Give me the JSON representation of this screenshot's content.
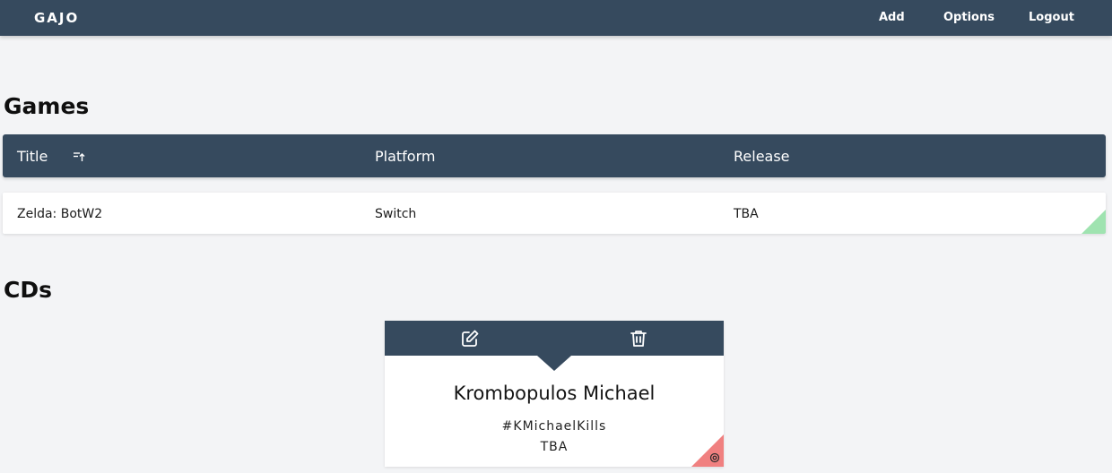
{
  "navbar": {
    "brand": "GAJO",
    "links": {
      "add": "Add",
      "options": "Options",
      "logout": "Logout"
    }
  },
  "games": {
    "heading": "Games",
    "columns": {
      "title": "Title",
      "platform": "Platform",
      "release": "Release"
    },
    "rows": [
      {
        "title": "Zelda: BotW2",
        "platform": "Switch",
        "release": "TBA"
      }
    ]
  },
  "cds": {
    "heading": "CDs",
    "items": [
      {
        "title": "Krombopulos Michael",
        "tag": "#KMichaelKills",
        "release": "TBA"
      }
    ]
  },
  "colors": {
    "navbar": "#364a5e",
    "background": "#f3f4f6",
    "corner_green": "#9fe3b0",
    "corner_red": "#f08080"
  },
  "icons": [
    "sort-icon",
    "edit-icon",
    "trash-icon",
    "target-icon"
  ]
}
